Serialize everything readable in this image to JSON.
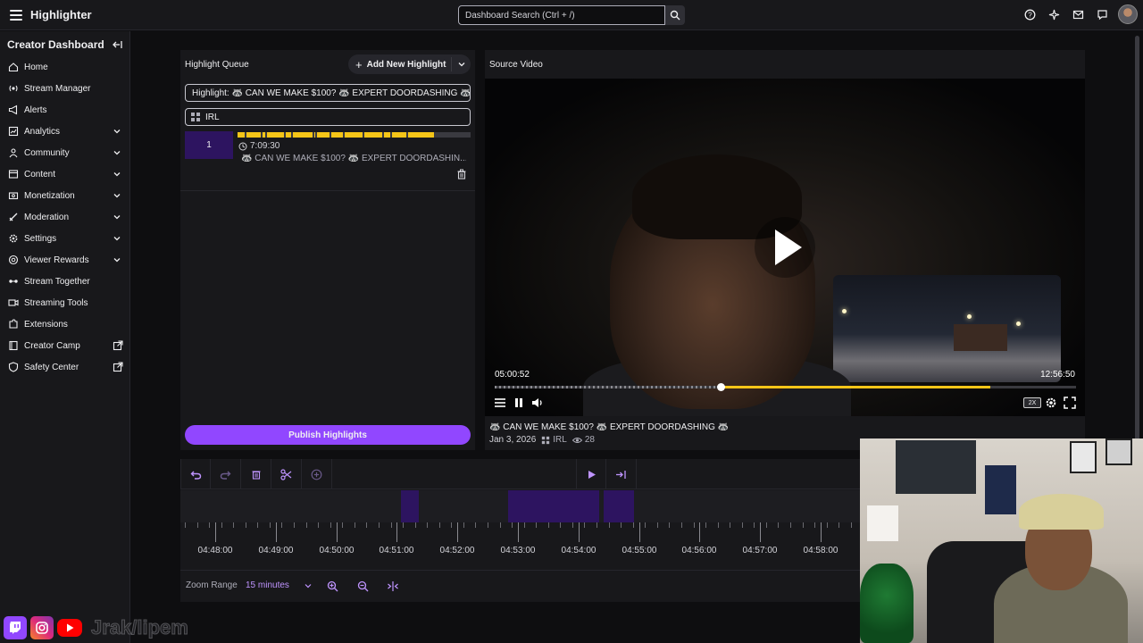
{
  "app": {
    "title": "Highlighter"
  },
  "search": {
    "placeholder": "Dashboard Search (Ctrl + /)"
  },
  "sidebar": {
    "heading": "Creator Dashboard",
    "items": [
      {
        "label": "Home",
        "icon": "home-icon",
        "expandable": false,
        "external": false
      },
      {
        "label": "Stream Manager",
        "icon": "stream-manager-icon",
        "expandable": false,
        "external": false
      },
      {
        "label": "Alerts",
        "icon": "megaphone-icon",
        "expandable": false,
        "external": false
      },
      {
        "label": "Analytics",
        "icon": "analytics-icon",
        "expandable": true,
        "external": false
      },
      {
        "label": "Community",
        "icon": "community-icon",
        "expandable": true,
        "external": false
      },
      {
        "label": "Content",
        "icon": "content-icon",
        "expandable": true,
        "external": false
      },
      {
        "label": "Monetization",
        "icon": "monetization-icon",
        "expandable": true,
        "external": false
      },
      {
        "label": "Moderation",
        "icon": "sword-icon",
        "expandable": true,
        "external": false
      },
      {
        "label": "Settings",
        "icon": "gear-icon",
        "expandable": true,
        "external": false
      },
      {
        "label": "Viewer Rewards",
        "icon": "rewards-icon",
        "expandable": true,
        "external": false
      },
      {
        "label": "Stream Together",
        "icon": "stream-together-icon",
        "expandable": false,
        "external": false
      },
      {
        "label": "Streaming Tools",
        "icon": "camera-icon",
        "expandable": false,
        "external": false
      },
      {
        "label": "Extensions",
        "icon": "puzzle-icon",
        "expandable": false,
        "external": false
      },
      {
        "label": "Creator Camp",
        "icon": "book-icon",
        "expandable": false,
        "external": true
      },
      {
        "label": "Safety Center",
        "icon": "shield-icon",
        "expandable": false,
        "external": true
      }
    ]
  },
  "queue": {
    "title": "Highlight Queue",
    "add_label": "Add New Highlight",
    "highlight_title": "Highlight: 🦝 CAN WE MAKE $100? 🦝 EXPERT DOORDASHING 🦝",
    "category": "IRL",
    "items": [
      {
        "number": "1",
        "duration": "7:09:30",
        "name": "🦝 CAN WE MAKE $100? 🦝 EXPERT DOORDASHIN..."
      }
    ],
    "publish_label": "Publish Highlights"
  },
  "video": {
    "title": "Source Video",
    "time_current": "05:00:52",
    "time_total": "12:56:50",
    "progress_fraction": 0.388,
    "speed": "2X",
    "stream_title": "🦝 CAN WE MAKE $100? 🦝 EXPERT DOORDASHING 🦝",
    "date": "Jan 3, 2026",
    "category": "IRL",
    "views": "28"
  },
  "timeline": {
    "ticks": [
      "04:48:00",
      "04:49:00",
      "04:50:00",
      "04:51:00",
      "04:52:00",
      "04:53:00",
      "04:54:00",
      "04:55:00",
      "04:56:00",
      "04:57:00",
      "04:58:00"
    ],
    "zoom_label": "Zoom Range",
    "zoom_value": "15 minutes"
  },
  "overlay": {
    "handle": "Jrak/lipem"
  },
  "colors": {
    "accent": "#9147ff",
    "highlight_bar": "#f5c518",
    "segment": "#2d1460",
    "bg": "#0e0e10",
    "panel": "#18181b"
  }
}
